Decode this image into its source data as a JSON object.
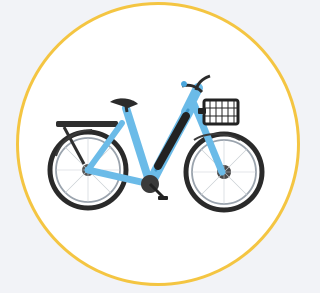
{
  "image": {
    "subject": "bike",
    "colors": {
      "background": "#f2f3f7",
      "ring": "#f4c542",
      "frame": "#6bbbe8",
      "frame_shadow": "#3f97c9",
      "tire": "#2a2a2a",
      "rim": "#9aa3ad",
      "accent_dark": "#333333"
    }
  }
}
